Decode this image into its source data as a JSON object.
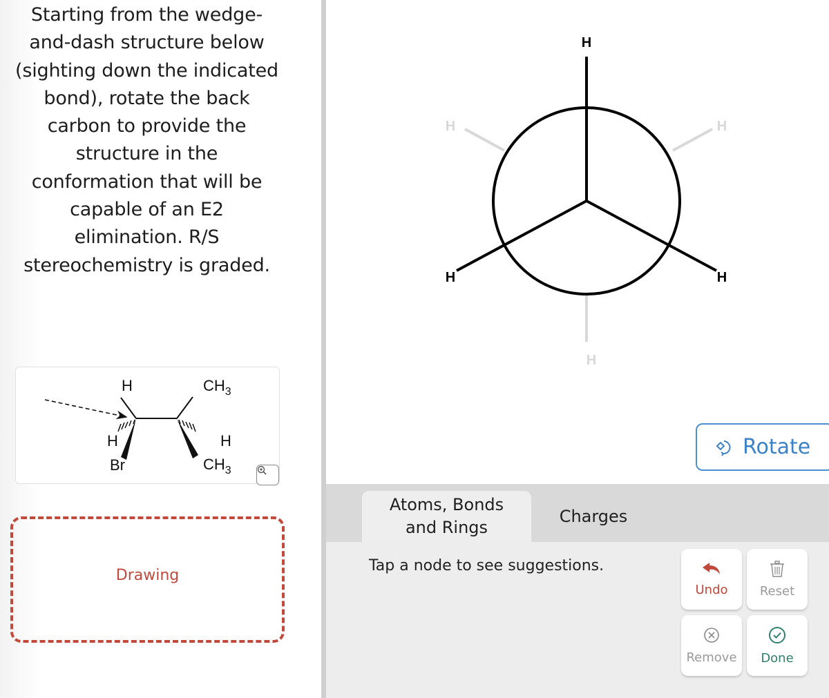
{
  "question": {
    "lines": [
      "Starting from the wedge-",
      "and-dash structure below",
      "(sighting down the indicated",
      "bond), rotate the back",
      "carbon to provide the",
      "structure in the",
      "conformation that will be",
      "capable of an E2",
      "elimination. R/S",
      "stereochemistry is graded."
    ]
  },
  "structure": {
    "front_carbon": {
      "top": "H",
      "dash": "H",
      "wedge": "Br"
    },
    "back_carbon": {
      "top": "CH3",
      "dash": "H",
      "wedge": "CH3"
    },
    "ch3_main": "CH",
    "ch3_sub": "3",
    "zoom_icon": "zoom-in-icon"
  },
  "drawing": {
    "label": "Drawing",
    "color": "#c24a3c"
  },
  "newman": {
    "front_labels": {
      "top": "H",
      "lower_left": "H",
      "lower_right": "H"
    },
    "back_labels": {
      "upper_left": "H",
      "upper_right": "H",
      "bottom": "H"
    },
    "front_color": "#000000",
    "back_color": "#d8d8d8"
  },
  "rotate_button": {
    "label": "Rotate",
    "icon": "rotate-icon",
    "color": "#3b82c8"
  },
  "tabs": [
    {
      "label_line1": "Atoms, Bonds",
      "label_line2": "and Rings",
      "active": true
    },
    {
      "label": "Charges",
      "active": false
    }
  ],
  "hint": "Tap a node to see suggestions.",
  "actions": {
    "undo": {
      "label": "Undo",
      "icon": "undo-arrow-icon",
      "color": "#c0483a"
    },
    "reset": {
      "label": "Reset",
      "icon": "trash-icon",
      "color": "#9a9a9a"
    },
    "remove": {
      "label": "Remove",
      "icon": "circle-x-icon",
      "color": "#9a9a9a"
    },
    "done": {
      "label": "Done",
      "icon": "circle-check-icon",
      "color": "#2f7f6e"
    }
  }
}
